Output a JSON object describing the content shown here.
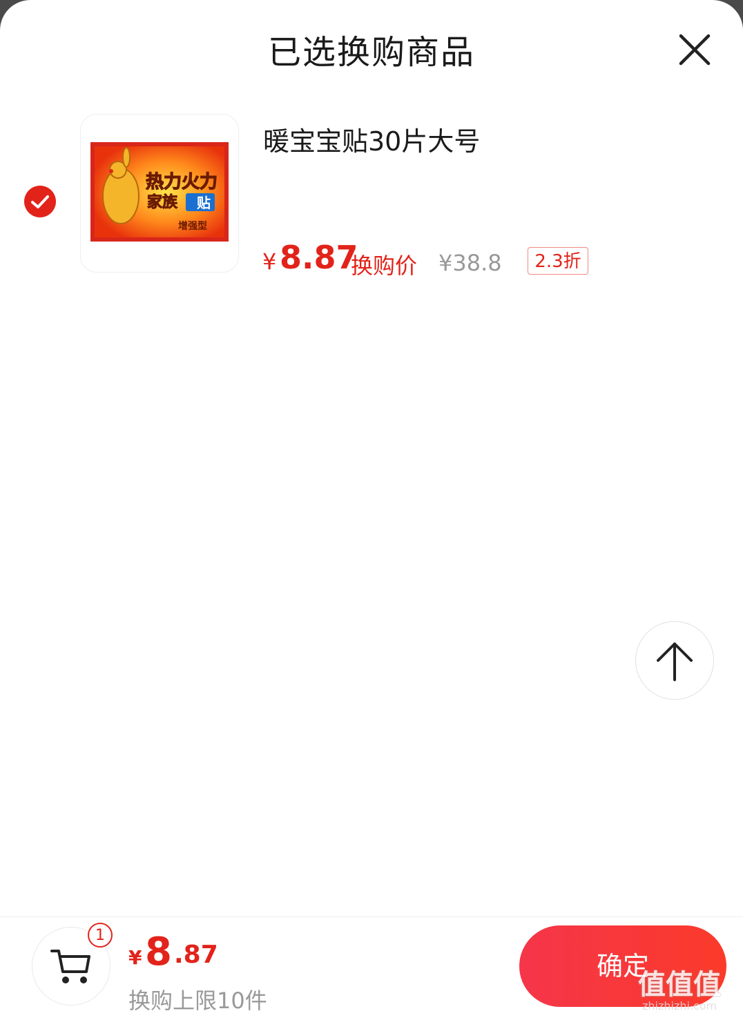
{
  "header": {
    "title": "已选换购商品"
  },
  "product": {
    "name": "暖宝宝贴30片大号",
    "selected": true,
    "price_currency": "¥",
    "price": "8.87",
    "price_label": "换购价",
    "original_price": "¥38.8",
    "discount": "2.3折",
    "thumbnail": {
      "brand_line1": "热力火力",
      "brand_line2": "家族",
      "brand_tag": "贴",
      "variant": "增强型"
    }
  },
  "footer": {
    "cart_count": "1",
    "total_currency": "¥",
    "total_int": "8",
    "total_dec": ".87",
    "limit_text": "换购上限10件",
    "confirm_label": "确定"
  },
  "watermark": {
    "logo": "值值值",
    "url": "zhizhizhi.com"
  },
  "colors": {
    "accent": "#e2231a",
    "confirm_gradient_start": "#f5364a",
    "confirm_gradient_end": "#fb3a2a",
    "muted_text": "#999999"
  },
  "icons": [
    "close-icon",
    "check-icon",
    "arrow-up-icon",
    "cart-icon"
  ]
}
